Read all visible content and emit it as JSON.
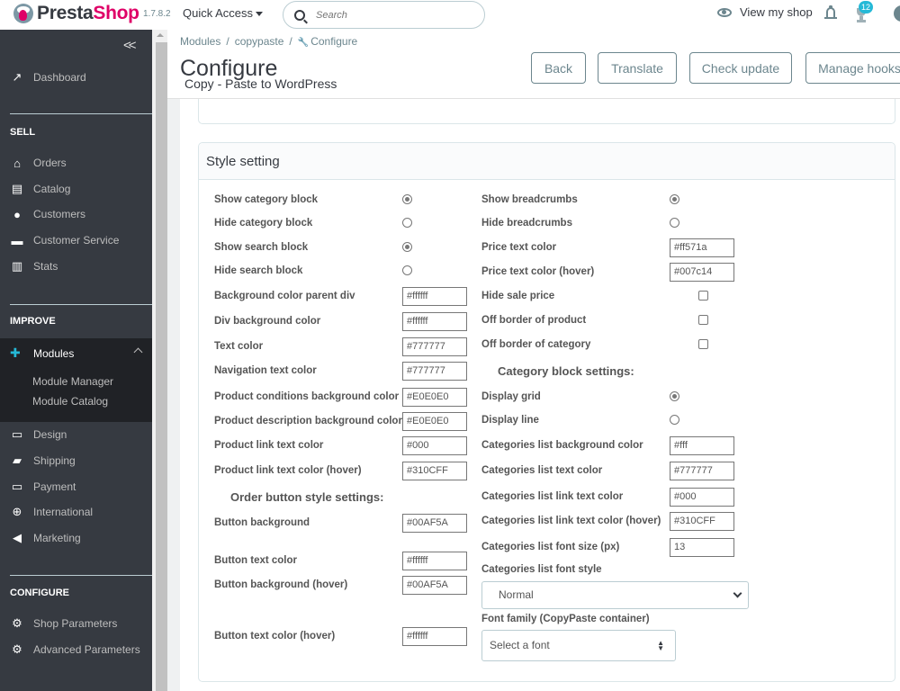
{
  "topbar": {
    "logo_part1": "Presta",
    "logo_part2": "Shop",
    "version": "1.7.8.2",
    "quick_access": "Quick Access",
    "search_placeholder": "Search",
    "view_shop": "View my shop",
    "notification_count": "12"
  },
  "sidebar": {
    "collapse": "«",
    "dashboard": "Dashboard",
    "sections": {
      "sell": "SELL",
      "improve": "IMPROVE",
      "configure": "CONFIGURE"
    },
    "sell_items": [
      "Orders",
      "Catalog",
      "Customers",
      "Customer Service",
      "Stats"
    ],
    "modules": "Modules",
    "module_sub": [
      "Module Manager",
      "Module Catalog"
    ],
    "improve_items": [
      "Design",
      "Shipping",
      "Payment",
      "International",
      "Marketing"
    ],
    "configure_items": [
      "Shop Parameters",
      "Advanced Parameters"
    ]
  },
  "header": {
    "breadcrumb": [
      "Modules",
      "copypaste",
      "Configure"
    ],
    "title": "Configure",
    "subtitle": "Copy - Paste to WordPress",
    "buttons": [
      "Back",
      "Translate",
      "Check update",
      "Manage hooks"
    ]
  },
  "panel": {
    "title": "Style setting",
    "left": {
      "radios": [
        {
          "label": "Show category block",
          "checked": true
        },
        {
          "label": "Hide category block",
          "checked": false
        },
        {
          "label": "Show search block",
          "checked": true
        },
        {
          "label": "Hide search block",
          "checked": false
        }
      ],
      "colors": [
        {
          "label": "Background color parent div",
          "value": "#ffffff"
        },
        {
          "label": "Div background color",
          "value": "#ffffff"
        },
        {
          "label": "Text color",
          "value": "#777777"
        },
        {
          "label": "Navigation text color",
          "value": "#777777"
        },
        {
          "label": "Product conditions background color",
          "value": "#E0E0E0"
        },
        {
          "label": "Product description background color",
          "value": "#E0E0E0"
        },
        {
          "label": "Product link text color",
          "value": "#000"
        },
        {
          "label": "Product link text color (hover)",
          "value": "#310CFF"
        }
      ],
      "order_heading": "Order button style settings:",
      "order": [
        {
          "label": "Button background",
          "value": "#00AF5A"
        },
        {
          "label": "Button text color",
          "value": "#ffffff"
        },
        {
          "label": "Button background (hover)",
          "value": "#00AF5A"
        },
        {
          "label": "Button text color (hover)",
          "value": "#ffffff"
        }
      ]
    },
    "right": {
      "radios": [
        {
          "label": "Show breadcrumbs",
          "checked": true
        },
        {
          "label": "Hide breadcrumbs",
          "checked": false
        }
      ],
      "price": [
        {
          "label": "Price text color",
          "value": "#ff571a"
        },
        {
          "label": "Price text color (hover)",
          "value": "#007c14"
        }
      ],
      "checks": [
        {
          "label": "Hide sale price",
          "checked": false
        },
        {
          "label": "Off border of product",
          "checked": false
        },
        {
          "label": "Off border of category",
          "checked": false
        }
      ],
      "category_heading": "Category block settings:",
      "display": [
        {
          "label": "Display grid",
          "checked": true
        },
        {
          "label": "Display line",
          "checked": false
        }
      ],
      "category": [
        {
          "label": "Categories list background color",
          "value": "#fff"
        },
        {
          "label": "Categories list text color",
          "value": "#777777"
        },
        {
          "label": "Categories list link text color",
          "value": "#000"
        },
        {
          "label": "Categories list link text color (hover)",
          "value": "#310CFF"
        },
        {
          "label": "Categories list font size (px)",
          "value": "13"
        }
      ],
      "font_style_label": "Categories list font style",
      "font_style_value": "Normal",
      "font_family_label": "Font family (CopyPaste container)",
      "font_family_value": "Select a font"
    }
  }
}
